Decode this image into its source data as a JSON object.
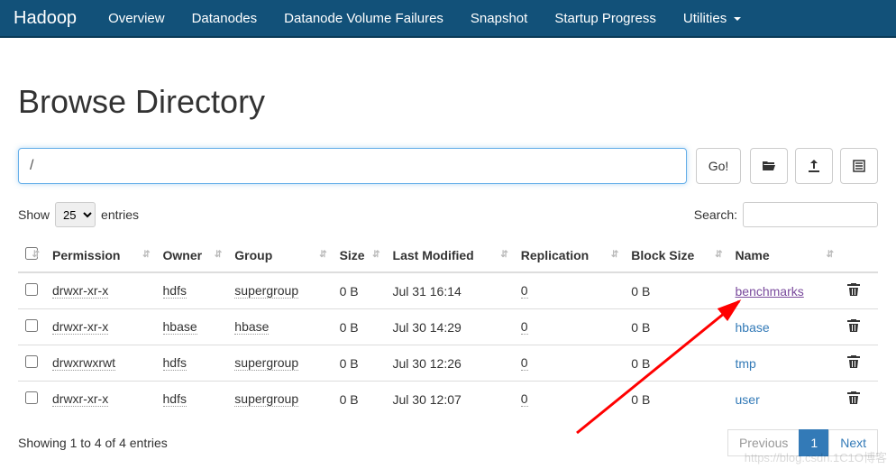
{
  "navbar": {
    "brand": "Hadoop",
    "items": [
      "Overview",
      "Datanodes",
      "Datanode Volume Failures",
      "Snapshot",
      "Startup Progress",
      "Utilities"
    ]
  },
  "page": {
    "title": "Browse Directory",
    "path_value": "/",
    "go_label": "Go!"
  },
  "controls": {
    "show_label": "Show",
    "entries_label": "entries",
    "entries_value": "25",
    "search_label": "Search:",
    "search_value": ""
  },
  "table": {
    "headers": [
      "Permission",
      "Owner",
      "Group",
      "Size",
      "Last Modified",
      "Replication",
      "Block Size",
      "Name"
    ],
    "rows": [
      {
        "permission": "drwxr-xr-x",
        "owner": "hdfs",
        "group": "supergroup",
        "size": "0 B",
        "modified": "Jul 31 16:14",
        "replication": "0",
        "blocksize": "0 B",
        "name": "benchmarks",
        "visited": true
      },
      {
        "permission": "drwxr-xr-x",
        "owner": "hbase",
        "group": "hbase",
        "size": "0 B",
        "modified": "Jul 30 14:29",
        "replication": "0",
        "blocksize": "0 B",
        "name": "hbase",
        "visited": false
      },
      {
        "permission": "drwxrwxrwt",
        "owner": "hdfs",
        "group": "supergroup",
        "size": "0 B",
        "modified": "Jul 30 12:26",
        "replication": "0",
        "blocksize": "0 B",
        "name": "tmp",
        "visited": false
      },
      {
        "permission": "drwxr-xr-x",
        "owner": "hdfs",
        "group": "supergroup",
        "size": "0 B",
        "modified": "Jul 30 12:07",
        "replication": "0",
        "blocksize": "0 B",
        "name": "user",
        "visited": false
      }
    ]
  },
  "footer": {
    "info": "Showing 1 to 4 of 4 entries",
    "prev": "Previous",
    "next": "Next",
    "page": "1"
  },
  "watermark": "https://blog.csdn.1C1O博客"
}
